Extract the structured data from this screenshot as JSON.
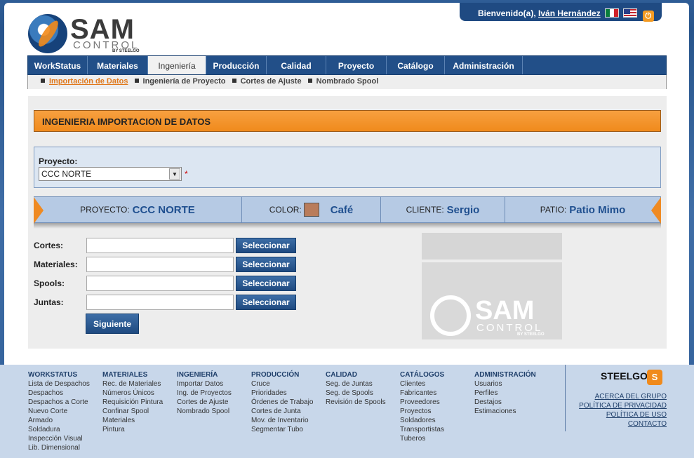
{
  "header": {
    "welcome_prefix": "Bienvenido(a),",
    "user_name": "Iván Hernández"
  },
  "logo": {
    "sam": "SAM",
    "control": "CONTROL",
    "by": "BY STEELGO"
  },
  "nav": {
    "items": [
      "WorkStatus",
      "Materiales",
      "Ingeniería",
      "Producción",
      "Calidad",
      "Proyecto",
      "Catálogo",
      "Administración"
    ],
    "active": "Ingeniería"
  },
  "subnav": {
    "items": [
      "Importación de Datos",
      "Ingeniería de Proyecto",
      "Cortes de Ajuste",
      "Nombrado Spool"
    ]
  },
  "page_title": "INGENIERIA IMPORTACION DE DATOS",
  "project_select": {
    "label": "Proyecto:",
    "value": "CCC NORTE",
    "required_mark": "*"
  },
  "infobar": {
    "proyecto_label": "PROYECTO:",
    "proyecto_value": "CCC NORTE",
    "color_label": "COLOR:",
    "color_value": "Café",
    "color_swatch": "#b97c5b",
    "cliente_label": "CLIENTE:",
    "cliente_value": "Sergio",
    "patio_label": "PATIO:",
    "patio_value": "Patio Mimo"
  },
  "form": {
    "rows": [
      {
        "label": "Cortes:",
        "button": "Seleccionar"
      },
      {
        "label": "Materiales:",
        "button": "Seleccionar"
      },
      {
        "label": "Spools:",
        "button": "Seleccionar"
      },
      {
        "label": "Juntas:",
        "button": "Seleccionar"
      }
    ],
    "next_button": "Siguiente"
  },
  "footer": {
    "columns": [
      {
        "title": "WORKSTATUS",
        "links": [
          "Lista de Despachos",
          "Despachos",
          "Despachos a Corte",
          "Nuevo Corte",
          "Armado",
          "Soldadura",
          "Inspección Visual",
          "Lib. Dimensional"
        ]
      },
      {
        "title": "MATERIALES",
        "links": [
          "Rec. de Materiales",
          "Números Únicos",
          "Requisición Pintura",
          "Confinar Spool",
          "Materiales",
          "Pintura"
        ]
      },
      {
        "title": "INGENIERÍA",
        "links": [
          "Importar Datos",
          "Ing. de Proyectos",
          "Cortes de Ajuste",
          "Nombrado Spool"
        ]
      },
      {
        "title": "PRODUCCIÓN",
        "links": [
          "Cruce",
          "Prioridades",
          "Órdenes de Trabajo",
          "Cortes de Junta",
          "Mov. de Inventario",
          "Segmentar Tubo"
        ]
      },
      {
        "title": "CALIDAD",
        "links": [
          "Seg. de Juntas",
          "Seg. de Spools",
          "Revisión de Spools"
        ]
      },
      {
        "title": "CATÁLOGOS",
        "links": [
          "Clientes",
          "Fabricantes",
          "Proveedores",
          "Proyectos",
          "Soldadores",
          "Transportistas",
          "Tuberos"
        ]
      },
      {
        "title": "ADMINISTRACIÓN",
        "links": [
          "Usuarios",
          "Perfiles",
          "Destajos",
          "Estimaciones"
        ]
      }
    ],
    "brand": "STEELGO",
    "links": [
      "ACERCA DEL GRUPO",
      "POLÍTICA DE PRIVACIDAD",
      "POLÍTICA DE USO",
      "CONTACTO"
    ]
  }
}
